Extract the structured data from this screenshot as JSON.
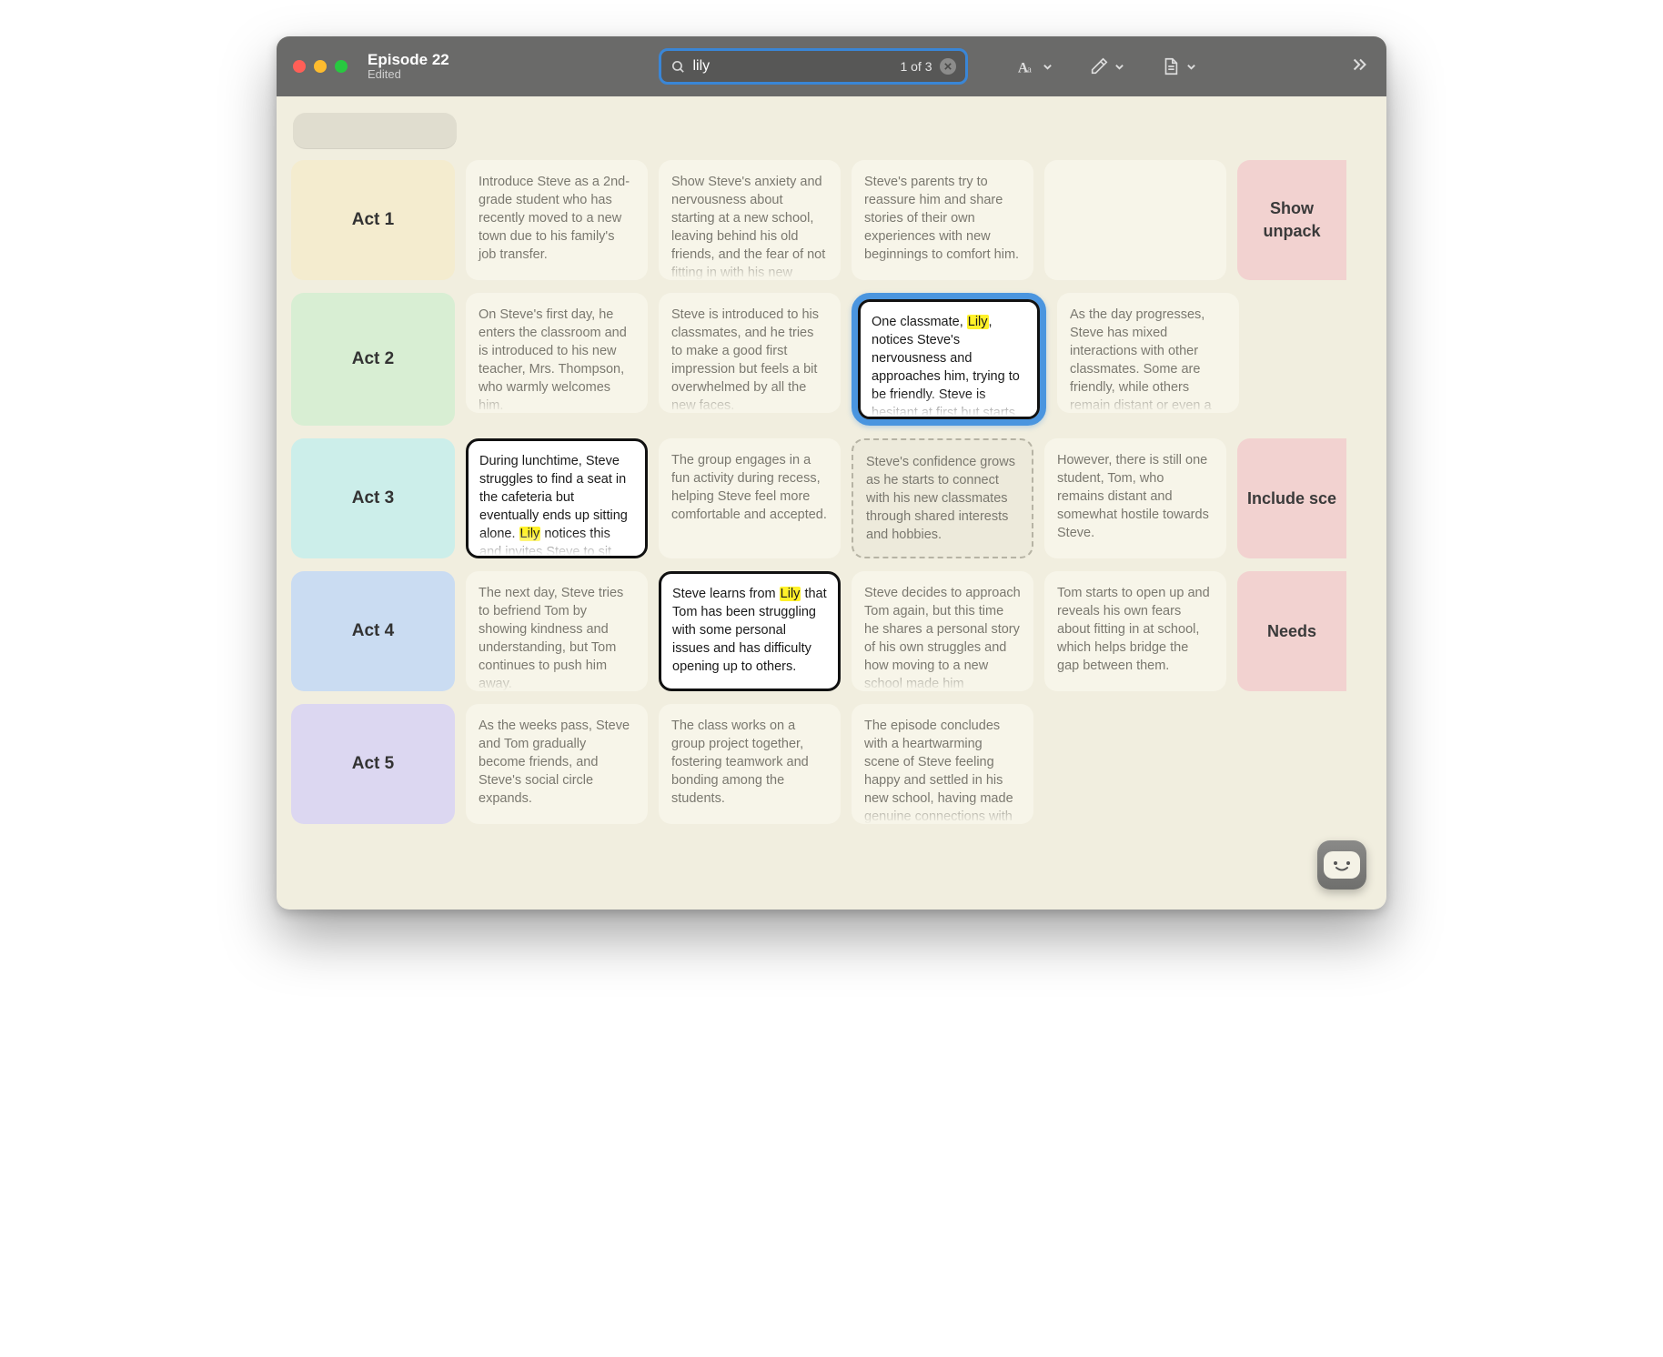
{
  "window": {
    "title": "Episode 22",
    "subtitle": "Edited"
  },
  "search": {
    "query": "lily",
    "result_count": "1 of 3"
  },
  "acts": [
    {
      "label": "Act 1",
      "cards": [
        {
          "style": "plain",
          "text": "Introduce Steve as a 2nd-grade student who has recently moved to a new town due to his family's job transfer."
        },
        {
          "style": "plain",
          "text": "Show Steve's anxiety and nervousness about starting at a new school, leaving behind his old friends, and the fear of not fitting in with his new "
        },
        {
          "style": "plain",
          "text": "Steve's parents try to reassure him and share stories of their own experiences with new beginnings to comfort him."
        },
        {
          "style": "plain",
          "text": ""
        },
        {
          "style": "pink",
          "text": "Show unpack"
        }
      ]
    },
    {
      "label": "Act 2",
      "cards": [
        {
          "style": "plain",
          "text": "On Steve's first day, he enters the classroom and is introduced to his new teacher, Mrs. Thompson, who warmly welcomes him."
        },
        {
          "style": "plain",
          "text": "Steve is introduced to his classmates, and he tries to make a good first impression but feels a bit overwhelmed by all the new faces."
        },
        {
          "style": "selected",
          "pre": "One classmate, ",
          "hl": "Lily",
          "post": ", notices Steve's nervousness and approaches him, trying to be friendly. Steve is hesitant at first but starts "
        },
        {
          "style": "plain",
          "text": "As the day progresses, Steve has mixed interactions with other classmates. Some are friendly, while others remain distant or even a "
        }
      ]
    },
    {
      "label": "Act 3",
      "cards": [
        {
          "style": "match",
          "pre": "During lunchtime, Steve struggles to find a seat in the cafeteria but eventually ends up sitting alone. ",
          "hl": "Lily",
          "post": " notices this and invites Steve to sit with "
        },
        {
          "style": "plain",
          "text": "The group engages in a fun activity during recess, helping Steve feel more comfortable and accepted."
        },
        {
          "style": "dashed",
          "text": "Steve's confidence grows as he starts to connect with his new classmates through shared interests and hobbies."
        },
        {
          "style": "plain",
          "text": "However, there is still one student, Tom, who remains distant and somewhat hostile towards Steve."
        },
        {
          "style": "pink",
          "text": "Include sce"
        }
      ]
    },
    {
      "label": "Act 4",
      "cards": [
        {
          "style": "plain",
          "text": "The next day, Steve tries to befriend Tom by showing kindness and understanding, but Tom continues to push him away."
        },
        {
          "style": "match",
          "pre": "Steve learns from ",
          "hl": "Lily",
          "post": " that Tom has been struggling with some personal issues and has difficulty opening up to others."
        },
        {
          "style": "plain",
          "text": "Steve decides to approach Tom again, but this time he shares a personal story of his own struggles and how moving to a new school made him "
        },
        {
          "style": "plain",
          "text": "Tom starts to open up and reveals his own fears about fitting in at school, which helps bridge the gap between them."
        },
        {
          "style": "pink",
          "text": "Needs"
        }
      ]
    },
    {
      "label": "Act 5",
      "cards": [
        {
          "style": "plain",
          "text": "As the weeks pass, Steve and Tom gradually become friends, and Steve's social circle expands."
        },
        {
          "style": "plain",
          "text": "The class works on a group project together, fostering teamwork and bonding among the students."
        },
        {
          "style": "plain",
          "text": "The episode concludes with a heartwarming scene of Steve feeling happy and settled in his new school, having made genuine connections with "
        }
      ]
    }
  ]
}
